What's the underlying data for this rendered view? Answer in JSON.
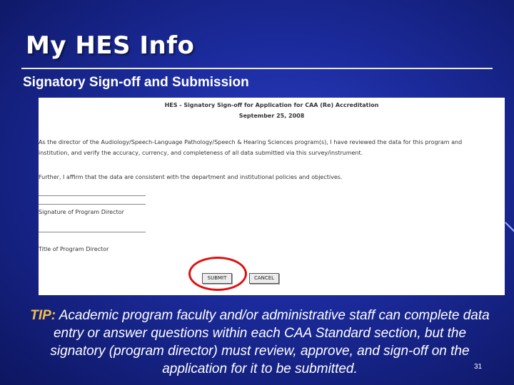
{
  "slide": {
    "title": "My HES Info",
    "subtitle": "Signatory Sign-off and Submission",
    "page_number": "31"
  },
  "form": {
    "heading": "HES - Signatory Sign-off for Application for CAA (Re) Accreditation",
    "date": "September 25, 2008",
    "paragraph1": "As the director of the Audiology/Speech-Language Pathology/Speech & Hearing Sciences program(s), I have reviewed the data for this program and institution, and verify the accuracy, currency, and completeness of all data submitted via this survey/instrument.",
    "paragraph2": "Further, I affirm that the data are consistent with the department and institutional policies and objectives.",
    "signature_label": "Signature of Program Director",
    "title_label": "Title of Program Director",
    "submit_label": "SUBMIT",
    "cancel_label": "CANCEL"
  },
  "tip": {
    "label": "TIP:",
    "text": " Academic program faculty and/or administrative staff can complete data entry or answer questions within each CAA Standard section, but the signatory (program director) must review, approve, and sign-off on the application for it to be submitted."
  },
  "colors": {
    "background": "#1b2a9a",
    "tip_label": "#f2c14b",
    "highlight": "#dd1111"
  }
}
